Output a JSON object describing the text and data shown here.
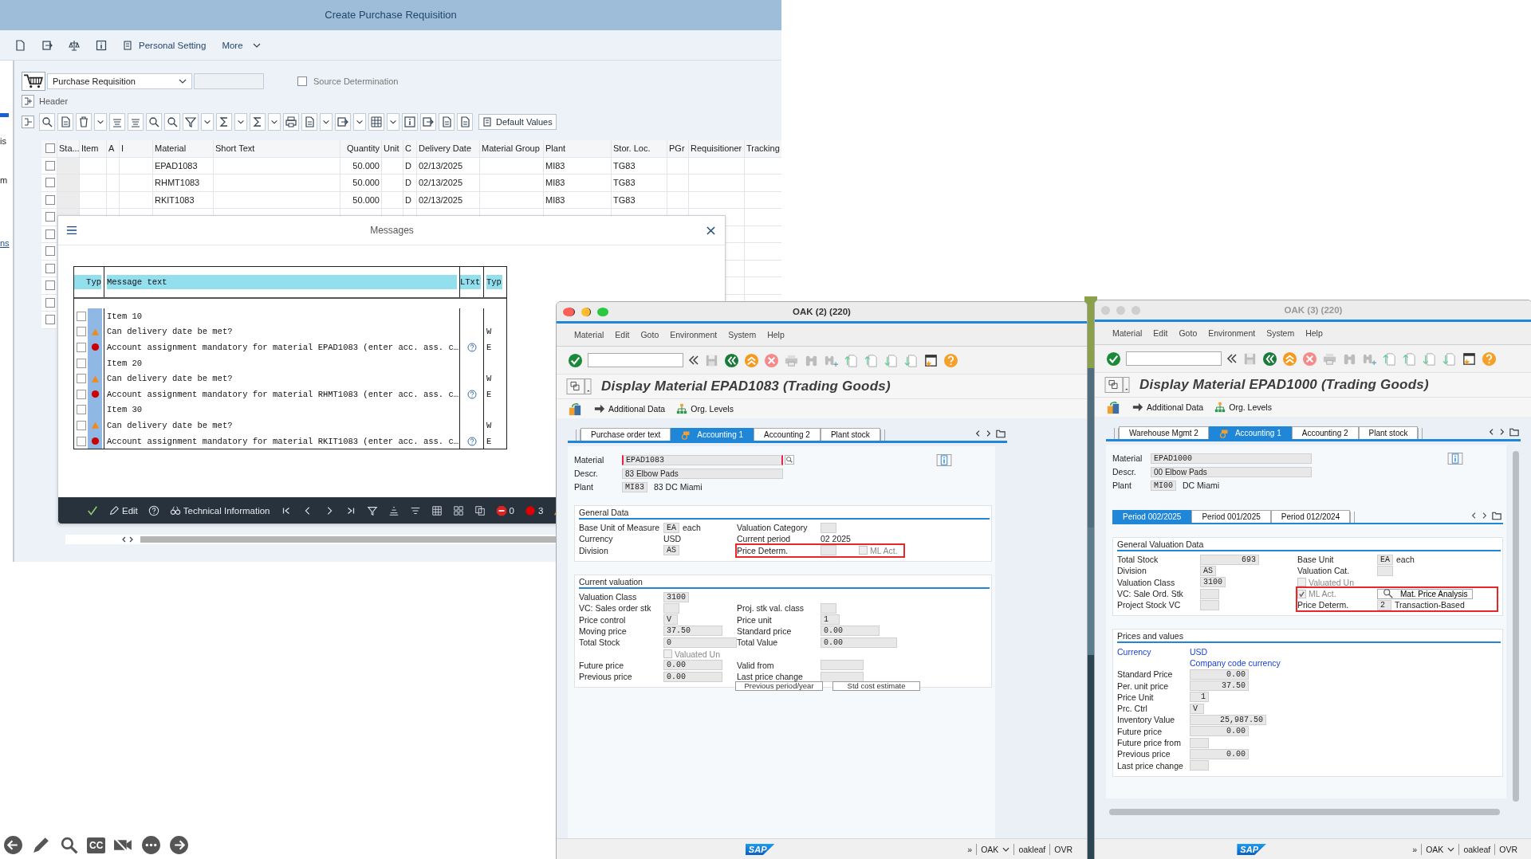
{
  "fiori": {
    "title": "Create Purchase Requisition",
    "toolbar": {
      "personal_setting": "Personal Setting",
      "more": "More"
    },
    "sidebar_fragments": [
      {
        "text": "is",
        "kind": "text"
      },
      {
        "text": "m",
        "kind": "text"
      },
      {
        "text": "ns",
        "kind": "link"
      }
    ],
    "doc_type": "Purchase Requisition",
    "source_determination": {
      "label": "Source Determination",
      "checked": false
    },
    "header_label": "Header",
    "default_values": "Default Values",
    "table": {
      "columns": [
        "Sta...",
        "Item",
        "A",
        "I",
        "Material",
        "Short Text",
        "Quantity",
        "Unit",
        "C",
        "Delivery Date",
        "Material Group",
        "Plant",
        "Stor. Loc.",
        "PGr",
        "Requisitioner",
        "Tracking"
      ],
      "select_all_checked": false,
      "empty_rows": [
        {
          "checked": false
        },
        {
          "checked": false
        },
        {
          "checked": false
        },
        {
          "checked": false
        },
        {
          "checked": false
        },
        {
          "checked": false
        },
        {
          "checked": false
        }
      ],
      "rows": [
        {
          "cells": [
            "",
            "",
            "",
            "",
            "EPAD1083",
            "",
            "50.000",
            "",
            "D",
            "02/13/2025",
            "",
            "MI83",
            "TG83",
            "",
            "",
            ""
          ],
          "checked": false
        },
        {
          "cells": [
            "",
            "",
            "",
            "",
            "RHMT1083",
            "",
            "50.000",
            "",
            "D",
            "02/13/2025",
            "",
            "MI83",
            "TG83",
            "",
            "",
            ""
          ],
          "checked": false
        },
        {
          "cells": [
            "",
            "",
            "",
            "",
            "RKIT1083",
            "",
            "50.000",
            "",
            "D",
            "02/13/2025",
            "",
            "MI83",
            "TG83",
            "",
            "",
            ""
          ],
          "checked": false
        }
      ]
    }
  },
  "messages": {
    "title": "Messages",
    "columns": [
      "Typ",
      "Message text",
      "LTxt",
      "Typ"
    ],
    "rows": [
      {
        "kind": "item",
        "text": "Item 10",
        "long_text": false,
        "checked": false
      },
      {
        "kind": "warning",
        "text": "Can delivery date be met?",
        "type": "W",
        "long_text": false,
        "checked": false
      },
      {
        "kind": "error",
        "text": "Account assignment mandatory for material EPAD1083 (enter acc. ass. c…",
        "type": "E",
        "long_text": true,
        "checked": false
      },
      {
        "kind": "item",
        "text": "Item 20",
        "long_text": false,
        "checked": false
      },
      {
        "kind": "warning",
        "text": "Can delivery date be met?",
        "type": "W",
        "long_text": false,
        "checked": false
      },
      {
        "kind": "error",
        "text": "Account assignment mandatory for material RHMT1083 (enter acc. ass. c…",
        "type": "E",
        "long_text": true,
        "checked": false
      },
      {
        "kind": "item",
        "text": "Item 30",
        "long_text": false,
        "checked": false
      },
      {
        "kind": "warning",
        "text": "Can delivery date be met?",
        "type": "W",
        "long_text": false,
        "checked": false
      },
      {
        "kind": "error",
        "text": "Account assignment mandatory for material RKIT1083 (enter acc. ass. c…",
        "type": "E",
        "long_text": true,
        "checked": false
      }
    ],
    "footer": {
      "edit": "Edit",
      "technical_information": "Technical Information",
      "stop_count": "0",
      "error_count": "3"
    }
  },
  "windows": [
    {
      "title": "OAK (2) (220)",
      "active": true,
      "menu": [
        "Material",
        "Edit",
        "Goto",
        "Environment",
        "System",
        "Help"
      ],
      "heading": "Display Material EPAD1083 (Trading Goods)",
      "additional_data": "Additional Data",
      "org_levels": "Org. Levels",
      "tabs": [
        {
          "label": "Purchase order text",
          "selected": false
        },
        {
          "label": "Accounting 1",
          "selected": true
        },
        {
          "label": "Accounting 2",
          "selected": false
        },
        {
          "label": "Plant stock",
          "selected": false
        }
      ],
      "material": {
        "label": "Material",
        "value": "EPAD1083"
      },
      "descr": {
        "label": "Descr.",
        "value": "83 Elbow Pads"
      },
      "plant": {
        "label": "Plant",
        "value": "MI83",
        "text": "83 DC Miami"
      },
      "sections": [
        {
          "title": "General Data",
          "rows": [
            [
              {
                "label": "Base Unit of Measure",
                "kind": "code",
                "value": "EA",
                "unit": "each"
              },
              {
                "label": "Valuation Category",
                "kind": "code"
              }
            ],
            [
              {
                "label": "Currency",
                "kind": "text",
                "value": "USD"
              },
              {
                "label": "Current period",
                "kind": "text",
                "value": "02 2025"
              }
            ],
            [
              {
                "label": "Division",
                "kind": "code",
                "value": "AS"
              },
              {
                "kind": "group",
                "highlighted": true,
                "rows": [
                  {
                    "label": "Price Determ.",
                    "kind": "code",
                    "checkbox": {
                      "label": "ML Act.",
                      "checked": false,
                      "disabled": true
                    }
                  }
                ]
              }
            ]
          ]
        },
        {
          "title": "Current valuation",
          "rows": [
            [
              {
                "label": "Valuation Class",
                "kind": "code",
                "value": "3100"
              }
            ],
            [
              {
                "label": "VC: Sales order stk",
                "kind": "mid"
              },
              {
                "label": "Proj. stk val. class",
                "kind": "mid"
              }
            ],
            [
              {
                "label": "Price control",
                "kind": "code",
                "value": "V"
              },
              {
                "label": "Price unit",
                "kind": "mid",
                "value": "1"
              }
            ],
            [
              {
                "label": "Moving price",
                "kind": "amount",
                "value": "37.50"
              },
              {
                "label": "Standard price",
                "kind": "amount",
                "value": "0.00"
              }
            ],
            [
              {
                "label": "Total Stock",
                "kind": "wide",
                "value": "0"
              },
              {
                "label": "Total Value",
                "kind": "wide",
                "value": "0.00"
              }
            ],
            [
              {
                "kind": "checkbox",
                "label": "Valuated Un",
                "checked": false,
                "disabled": true
              }
            ],
            [
              {
                "label": "Future price",
                "kind": "amount",
                "value": "0.00"
              },
              {
                "label": "Valid from",
                "kind": "amount"
              }
            ],
            [
              {
                "label": "Previous price",
                "kind": "amount",
                "value": "0.00"
              },
              {
                "label": "Last price change",
                "kind": "amount"
              }
            ]
          ]
        }
      ],
      "buttons": [
        "Previous period/year",
        "Std cost estimate"
      ],
      "status": {
        "logo": "SAP",
        "items": [
          "»",
          "OAK",
          "oakleaf",
          "OVR"
        ]
      }
    },
    {
      "title": "OAK (3) (220)",
      "active": false,
      "menu": [
        "Material",
        "Edit",
        "Goto",
        "Environment",
        "System",
        "Help"
      ],
      "heading": "Display Material EPAD1000 (Trading Goods)",
      "additional_data": "Additional Data",
      "org_levels": "Org. Levels",
      "tabs": [
        {
          "label": "Warehouse Mgmt 2",
          "selected": false
        },
        {
          "label": "Accounting 1",
          "selected": true
        },
        {
          "label": "Accounting 2",
          "selected": false
        },
        {
          "label": "Plant stock",
          "selected": false
        }
      ],
      "material": {
        "label": "Material",
        "value": "EPAD1000"
      },
      "descr": {
        "label": "Descr.",
        "value": "00 Elbow Pads"
      },
      "plant": {
        "label": "Plant",
        "value": "MI00",
        "text": "DC Miami"
      },
      "period_tabs": [
        {
          "label": "Period 002/2025",
          "selected": true
        },
        {
          "label": "Period 001/2025",
          "selected": false
        },
        {
          "label": "Period 012/2024",
          "selected": false
        }
      ],
      "sections": [
        {
          "title": "General Valuation Data",
          "rows": [
            [
              {
                "label": "Total Stock",
                "kind": "amount",
                "value": "693"
              },
              {
                "label": "Base Unit",
                "kind": "code",
                "value": "EA",
                "unit": "each"
              }
            ],
            [
              {
                "label": "Division",
                "kind": "code",
                "value": "AS"
              },
              {
                "label": "Valuation Cat.",
                "kind": "code"
              }
            ],
            [
              {
                "label": "Valuation Class",
                "kind": "code",
                "value": "3100"
              },
              {
                "kind": "flag",
                "label": "Valuated Un",
                "checked": false,
                "disabled": true
              }
            ],
            [
              {
                "label": "VC: Sale Ord. Stk",
                "kind": "mid"
              },
              {
                "kind": "group",
                "highlighted": true,
                "rows": [
                  {
                    "kind": "flag",
                    "label": "ML Act.",
                    "checked": true,
                    "disabled": true,
                    "button": "Mat. Price Analysis"
                  },
                  {
                    "label": "Price Determ.",
                    "kind": "code",
                    "value": "2",
                    "unit": "Transaction-Based"
                  }
                ]
              }
            ],
            [
              {
                "label": "Project Stock VC",
                "kind": "mid"
              }
            ]
          ]
        },
        {
          "title": "Prices and values",
          "rows": [
            [
              {
                "label": "Currency",
                "kind": "info",
                "value": "USD"
              }
            ],
            [
              {
                "kind": "info",
                "value": "Company code currency"
              }
            ],
            [
              {
                "label": "Standard Price",
                "kind": "amount",
                "value": "0.00"
              }
            ],
            [
              {
                "label": "Per. unit price",
                "kind": "amount",
                "value": "37.50"
              }
            ],
            [
              {
                "label": "Price Unit",
                "kind": "mid",
                "value": "1"
              }
            ],
            [
              {
                "label": "Prc. Ctrl",
                "kind": "code",
                "value": "V"
              }
            ],
            [
              {
                "label": "Inventory Value",
                "kind": "wide",
                "value": "25,987.50"
              }
            ],
            [
              {
                "label": "Future price",
                "kind": "amount",
                "value": "0.00"
              }
            ],
            [
              {
                "label": "Future price from",
                "kind": "mid"
              }
            ],
            [
              {
                "label": "Previous price",
                "kind": "amount",
                "value": "0.00"
              }
            ],
            [
              {
                "label": "Last price change",
                "kind": "mid"
              }
            ]
          ]
        }
      ],
      "status": {
        "logo": "SAP",
        "items": [
          "»",
          "OAK",
          "oakleaf",
          "OVR"
        ]
      }
    }
  ],
  "player": {
    "captions": "CC"
  }
}
